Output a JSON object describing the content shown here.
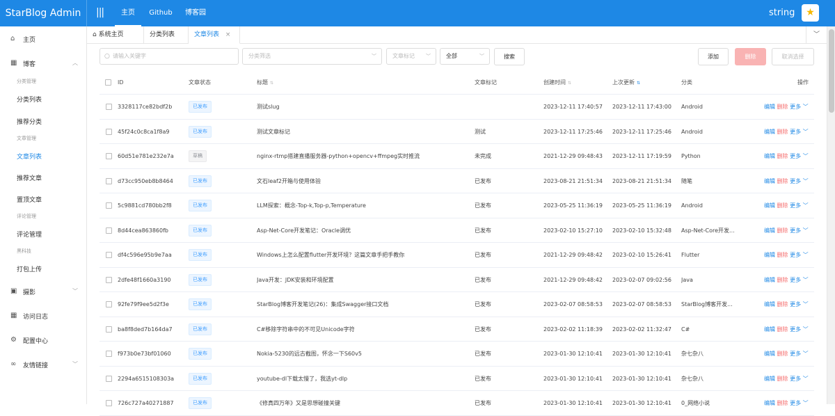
{
  "app": {
    "title": "StarBlog Admin"
  },
  "topnav": {
    "toggle_icon": "|||",
    "items": [
      "主页",
      "Github",
      "博客园"
    ]
  },
  "user": {
    "name": "string",
    "avatar_icon": "star-icon"
  },
  "sidebar": {
    "home": "主页",
    "blog": "博客",
    "groups": {
      "category_mgmt": "分类管理",
      "post_mgmt": "文章管理",
      "comment_mgmt": "评论管理",
      "black_tech": "黑科技"
    },
    "subs": {
      "category_list": "分类列表",
      "featured_category": "推荐分类",
      "post_list": "文章列表",
      "featured_post": "推荐文章",
      "top_post": "置顶文章",
      "comment_manage": "评论管理",
      "pack_upload": "打包上传"
    },
    "photo": "摄影",
    "visit_log": "访问日志",
    "config": "配置中心",
    "links": "友情链接"
  },
  "tabs": [
    "系统主页",
    "分类列表",
    "文章列表"
  ],
  "toolbar": {
    "search_placeholder": "请输入关键字",
    "category_placeholder": "分类筛选",
    "tag_placeholder": "文章标记",
    "status_value": "全部",
    "search_label": "搜索",
    "add_label": "添加",
    "delete_label": "删除",
    "cancel_label": "取消选择"
  },
  "table": {
    "columns": [
      "ID",
      "文章状态",
      "标题",
      "文章标记",
      "创建时间",
      "上次更新",
      "分类",
      "操作"
    ],
    "ops": {
      "edit": "编辑",
      "delete": "删除",
      "more": "更多"
    },
    "rows": [
      {
        "id": "3328117ce82bdf2b",
        "status": "已发布",
        "draft": false,
        "title": "测试slug",
        "tag": "",
        "created": "2023-12-11 17:40:57",
        "updated": "2023-12-11 17:43:00",
        "category": "Android"
      },
      {
        "id": "45f24c0c8ca1f8a9",
        "status": "已发布",
        "draft": false,
        "title": "测试文章标记",
        "tag": "测试",
        "created": "2023-12-11 17:25:46",
        "updated": "2023-12-11 17:25:46",
        "category": "Android"
      },
      {
        "id": "60d51e781e232e7a",
        "status": "草稿",
        "draft": true,
        "title": "nginx-rtmp搭建直播服务器-python+opencv+ffmpeg实时推流",
        "tag": "未完成",
        "created": "2021-12-29 09:48:43",
        "updated": "2023-12-11 17:19:59",
        "category": "Python"
      },
      {
        "id": "d73cc950eb8b8464",
        "status": "已发布",
        "draft": false,
        "title": "文石leaf2开箱与使用体验",
        "tag": "已发布",
        "created": "2023-08-21 21:51:34",
        "updated": "2023-08-21 21:51:34",
        "category": "随笔"
      },
      {
        "id": "5c9881cd780bb2f8",
        "status": "已发布",
        "draft": false,
        "title": "LLM探索：概念-Top-k,Top-p,Temperature",
        "tag": "已发布",
        "created": "2023-05-25 11:36:19",
        "updated": "2023-05-25 11:36:19",
        "category": "Android"
      },
      {
        "id": "8d44cea863860fb",
        "status": "已发布",
        "draft": false,
        "title": "Asp-Net-Core开发笔记：Oracle调优",
        "tag": "已发布",
        "created": "2023-02-10 15:27:10",
        "updated": "2023-02-10 15:32:48",
        "category": "Asp-Net-Core开发..."
      },
      {
        "id": "df4c596e95b9e7aa",
        "status": "已发布",
        "draft": false,
        "title": "Windows上怎么配置flutter开发环境？这篇文章手把手教你",
        "tag": "已发布",
        "created": "2021-12-29 09:48:42",
        "updated": "2023-02-10 15:26:41",
        "category": "Flutter"
      },
      {
        "id": "2dfe48f1660a3190",
        "status": "已发布",
        "draft": false,
        "title": "Java开发：JDK安装和环境配置",
        "tag": "已发布",
        "created": "2021-12-29 09:48:42",
        "updated": "2023-02-07 09:02:56",
        "category": "Java"
      },
      {
        "id": "92fe79f9ee5d2f3e",
        "status": "已发布",
        "draft": false,
        "title": "StarBlog博客开发笔记(26)：集成Swagger接口文档",
        "tag": "已发布",
        "created": "2023-02-07 08:58:53",
        "updated": "2023-02-07 08:58:53",
        "category": "StarBlog博客开发..."
      },
      {
        "id": "ba8f8ded7b164da7",
        "status": "已发布",
        "draft": false,
        "title": "C#移除字符串中的不可见Unicode字符",
        "tag": "已发布",
        "created": "2023-02-02 11:18:39",
        "updated": "2023-02-02 11:32:47",
        "category": "C#"
      },
      {
        "id": "f973b0e73bf01060",
        "status": "已发布",
        "draft": false,
        "title": "Nokia-5230的远古截图，怀念一下S60v5",
        "tag": "已发布",
        "created": "2023-01-30 12:10:41",
        "updated": "2023-01-30 12:10:41",
        "category": "杂七杂八"
      },
      {
        "id": "2294a6515108303a",
        "status": "已发布",
        "draft": false,
        "title": "youtube-dl下载太慢了，我选yt-dlp",
        "tag": "已发布",
        "created": "2023-01-30 12:10:41",
        "updated": "2023-01-30 12:10:41",
        "category": "杂七杂八"
      },
      {
        "id": "726c727a40271887",
        "status": "已发布",
        "draft": false,
        "title": "《修真四万年》又是思想碰撞关键",
        "tag": "已发布",
        "created": "2023-01-30 12:10:41",
        "updated": "2023-01-30 12:10:41",
        "category": "0_网络小说"
      }
    ]
  }
}
